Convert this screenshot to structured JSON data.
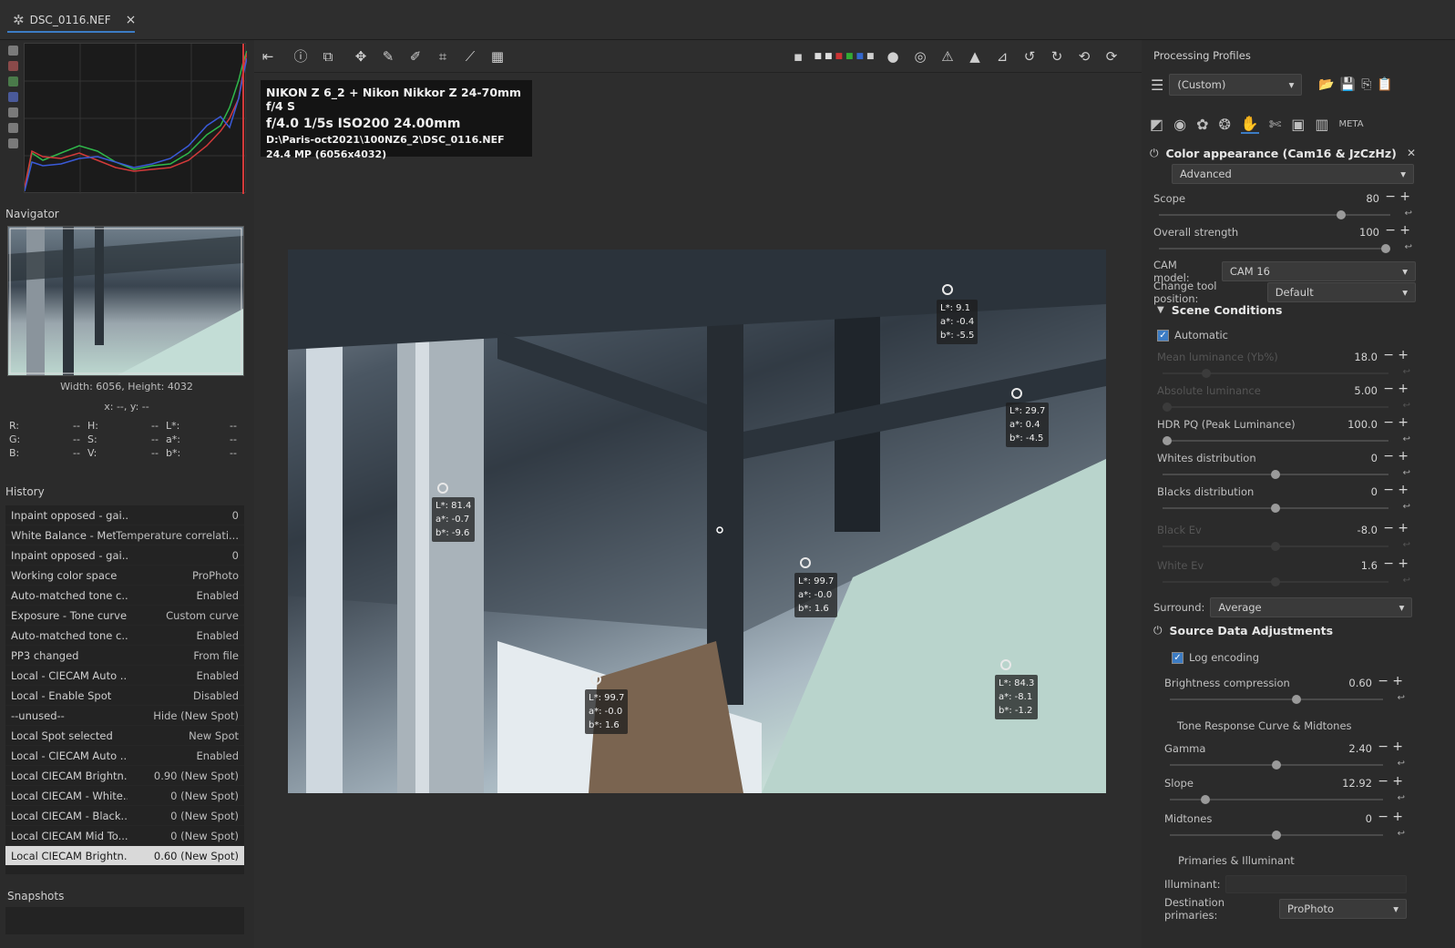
{
  "tab": {
    "title": "DSC_0116.NEF",
    "close": "×"
  },
  "navigator": {
    "title": "Navigator",
    "size": "Width: 6056, Height: 4032",
    "coords": "x: --, y: --",
    "values": [
      [
        "R:",
        "--",
        "H:",
        "--",
        "L*:",
        "--"
      ],
      [
        "G:",
        "--",
        "S:",
        "--",
        "a*:",
        "--"
      ],
      [
        "B:",
        "--",
        "V:",
        "--",
        "b*:",
        "--"
      ]
    ]
  },
  "history": {
    "title": "History",
    "rows": [
      [
        "Inpaint opposed - gai...",
        "0"
      ],
      [
        "White Balance - Meth...",
        "Temperature correlati..."
      ],
      [
        "Inpaint opposed - gai...",
        "0"
      ],
      [
        "Working color space",
        "ProPhoto"
      ],
      [
        "Auto-matched tone c...",
        "Enabled"
      ],
      [
        "Exposure - Tone curve 1",
        "Custom curve"
      ],
      [
        "Auto-matched tone c...",
        "Enabled"
      ],
      [
        "PP3 changed",
        "From file"
      ],
      [
        "Local - CIECAM Auto ...",
        "Enabled"
      ],
      [
        "Local - Enable Spot",
        "Disabled"
      ],
      [
        "--unused--",
        "Hide (New Spot)"
      ],
      [
        "Local Spot selected",
        "New Spot"
      ],
      [
        "Local - CIECAM Auto ...",
        "Enabled"
      ],
      [
        "Local CIECAM Brightn...",
        "0.90 (New Spot)"
      ],
      [
        "Local CIECAM - White...",
        "0 (New Spot)"
      ],
      [
        "Local CIECAM - Black...",
        "0 (New Spot)"
      ],
      [
        "Local CIECAM Mid To...",
        "0 (New Spot)"
      ],
      [
        "Local CIECAM Brightn...",
        "0.60 (New Spot)"
      ]
    ]
  },
  "snapshots": {
    "title": "Snapshots"
  },
  "info": {
    "line1": "NIKON Z 6_2 + Nikon Nikkor Z 24-70mm f/4 S",
    "line2": "f/4.0  1/5s  ISO200  24.00mm",
    "line3": "D:\\Paris-oct2021\\100NZ6_2\\DSC_0116.NEF",
    "line4": "24.4 MP (6056x4032)"
  },
  "spots": [
    {
      "l": "L*: 9.1",
      "a": "a*: -0.4",
      "b": "b*: -5.5"
    },
    {
      "l": "L*: 29.7",
      "a": "a*: 0.4",
      "b": "b*: -4.5"
    },
    {
      "l": "L*: 81.4",
      "a": "a*: -0.7",
      "b": "b*: -9.6"
    },
    {
      "l": "L*: 99.7",
      "a": "a*: -0.0",
      "b": "b*: 1.6"
    },
    {
      "l": "L*: 99.7",
      "a": "a*: -0.0",
      "b": "b*: 1.6"
    },
    {
      "l": "L*: 84.3",
      "a": "a*: -8.1",
      "b": "b*: -1.2"
    }
  ],
  "right": {
    "profiles_title": "Processing Profiles",
    "profile_value": "(Custom)",
    "module_title": "Color appearance (Cam16 & JzCzHz)",
    "mode": "Advanced",
    "scope_label": "Scope",
    "scope_value": "80",
    "strength_label": "Overall strength",
    "strength_value": "100",
    "cam_label": "CAM model:",
    "cam_value": "CAM 16",
    "pos_label": "Change tool position:",
    "pos_value": "Default",
    "scene_title": "Scene Conditions",
    "automatic": "Automatic",
    "mean_lum": "Mean luminance (Yb%)",
    "mean_val": "18.0",
    "abs_lum": "Absolute luminance",
    "abs_val": "5.00",
    "hdr_label": "HDR PQ (Peak Luminance)",
    "hdr_value": "100.0",
    "whites_label": "Whites distribution",
    "whites_value": "0",
    "blacks_label": "Blacks distribution",
    "blacks_value": "0",
    "black_ev": "Black Ev",
    "black_ev_val": "-8.0",
    "white_ev": "White Ev",
    "white_ev_val": "1.6",
    "surround_label": "Surround:",
    "surround_value": "Average",
    "source_title": "Source Data Adjustments",
    "log_enc": "Log encoding",
    "bright_label": "Brightness compression",
    "bright_value": "0.60",
    "trc_title": "Tone Response Curve & Midtones",
    "gamma_label": "Gamma",
    "gamma_value": "2.40",
    "slope_label": "Slope",
    "slope_value": "12.92",
    "mid_label": "Midtones",
    "mid_value": "0",
    "prim_title": "Primaries & Illuminant",
    "illum_label": "Illuminant:",
    "dest_label": "Destination primaries:",
    "dest_value": "ProPhoto"
  }
}
